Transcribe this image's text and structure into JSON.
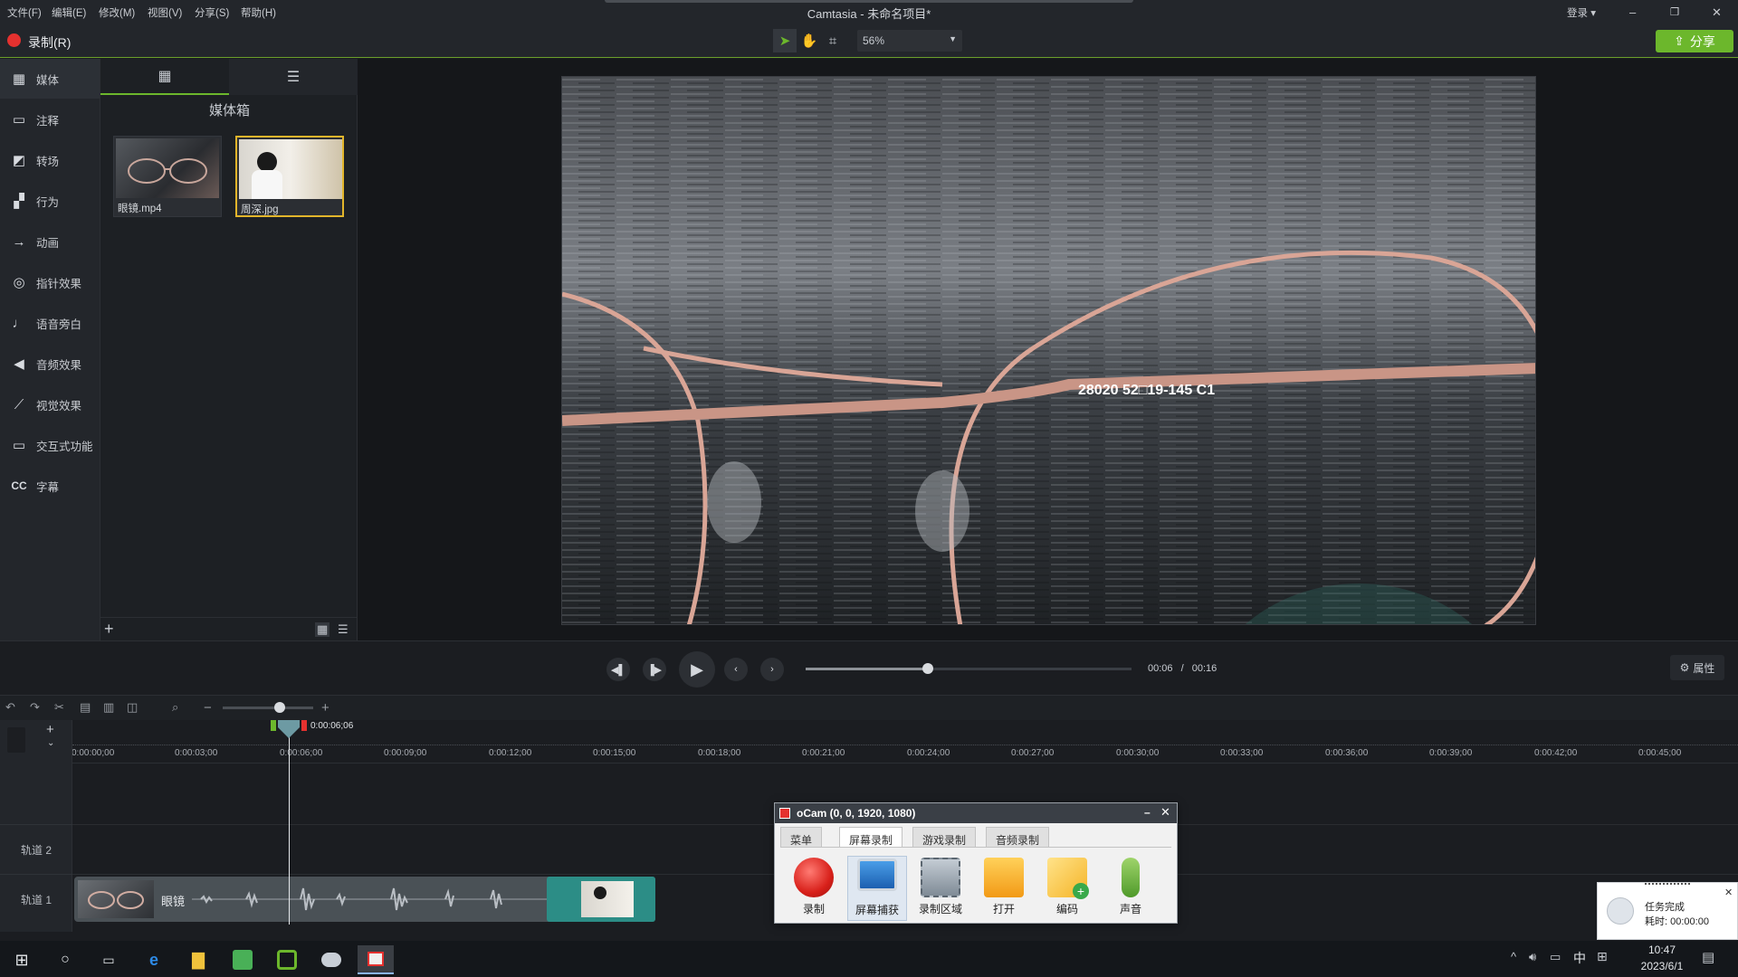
{
  "menubar": {
    "items": [
      "文件(F)",
      "编辑(E)",
      "修改(M)",
      "视图(V)",
      "分享(S)",
      "帮助(H)"
    ],
    "title": "Camtasia - 未命名项目*",
    "login": "登录 ▾",
    "window_controls": [
      "–",
      "❐",
      "✕"
    ]
  },
  "toolbar": {
    "record_label": "录制(R)",
    "zoom_value": "56%",
    "share_label": "分享"
  },
  "sidebar": {
    "items": [
      {
        "label": "媒体",
        "icon": "film-icon"
      },
      {
        "label": "注释",
        "icon": "annotation-icon"
      },
      {
        "label": "转场",
        "icon": "transition-icon"
      },
      {
        "label": "行为",
        "icon": "behavior-icon"
      },
      {
        "label": "动画",
        "icon": "animation-icon"
      },
      {
        "label": "指针效果",
        "icon": "cursor-effect-icon"
      },
      {
        "label": "语音旁白",
        "icon": "microphone-icon"
      },
      {
        "label": "音频效果",
        "icon": "speaker-icon"
      },
      {
        "label": "视觉效果",
        "icon": "magic-wand-icon"
      },
      {
        "label": "交互式功能",
        "icon": "interactive-icon"
      },
      {
        "label": "字幕",
        "icon": "cc-icon"
      }
    ]
  },
  "media_bin": {
    "title": "媒体箱",
    "items": [
      {
        "name": "眼镜.mp4"
      },
      {
        "name": "周深.jpg"
      }
    ]
  },
  "player": {
    "current_time": "00:06",
    "separator": "/",
    "total_time": "00:16",
    "progress_fraction": 0.375,
    "properties_label": "属性"
  },
  "timeline": {
    "playhead_time": "0:00:06;06",
    "ticks": [
      "0:00:00;00",
      "0:00:03;00",
      "0:00:06;00",
      "0:00:09;00",
      "0:00:12;00",
      "0:00:15;00",
      "0:00:18;00",
      "0:00:21;00",
      "0:00:24;00",
      "0:00:27;00",
      "0:00:30;00",
      "0:00:33;00",
      "0:00:36;00",
      "0:00:39;00",
      "0:00:42;00",
      "0:00:45;00"
    ],
    "tracks": [
      "轨道 2",
      "轨道 1"
    ],
    "clip_label": "眼镜"
  },
  "preview": {
    "overlay_text": "28020 52□19-145 C1"
  },
  "ocam": {
    "title": "oCam (0, 0, 1920, 1080)",
    "tabs": [
      "菜单",
      "屏幕录制",
      "游戏录制",
      "音频录制"
    ],
    "buttons": [
      "录制",
      "屏幕捕获",
      "录制区域",
      "打开",
      "编码",
      "声音"
    ]
  },
  "toast": {
    "title": "任务完成",
    "detail": "耗时: 00:00:00"
  },
  "taskbar": {
    "clock_time": "10:47",
    "clock_date": "2023/6/1",
    "ime": "中"
  },
  "colors": {
    "accent_green": "#6cb72c",
    "record_red": "#e5312f",
    "clip_teal": "#2c8d86"
  }
}
